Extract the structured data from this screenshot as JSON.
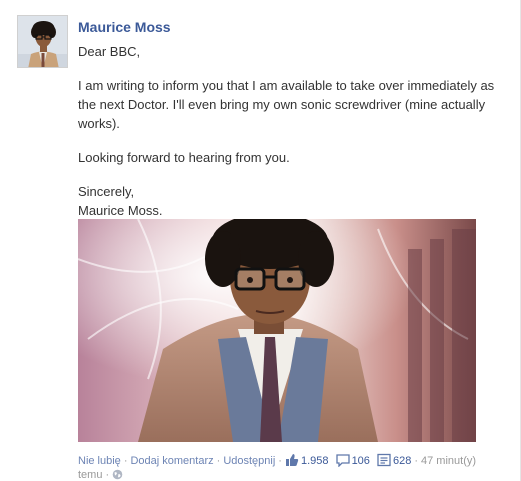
{
  "post": {
    "author": "Maurice Moss",
    "greeting": "Dear BBC,",
    "paragraph1": "I am writing to inform you that I am available to take over immediately as the next Doctor. I'll even bring my own sonic screwdriver (mine actually works).",
    "paragraph2": "Looking forward to hearing from you.",
    "closing": "Sincerely,",
    "signature": "Maurice Moss."
  },
  "actions": {
    "like": "Nie lubię",
    "comment": "Dodaj komentarz",
    "share": "Udostępnij",
    "likes_count": "1.958",
    "comments_count": "106",
    "shares_count": "628",
    "time_part1": "47 minut(y)",
    "time_part2": "temu"
  },
  "colors": {
    "link": "#3b5998",
    "meta": "#999999"
  },
  "icons": [
    "thumbs-up-icon",
    "comment-icon",
    "share-icon",
    "globe-icon"
  ]
}
